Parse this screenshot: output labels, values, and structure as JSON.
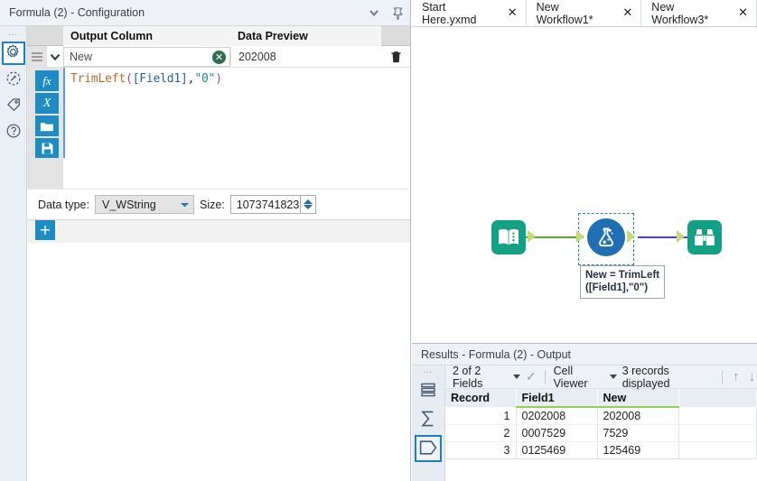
{
  "config_panel": {
    "title": "Formula (2) - Configuration",
    "collapse_icon": "chevron-down-icon",
    "pin_icon": "pushpin-icon",
    "rail": {
      "items": [
        {
          "name": "gear-icon",
          "label": "Configuration",
          "selected": true
        },
        {
          "name": "arrow-circle-icon",
          "label": "Annotation",
          "selected": false
        },
        {
          "name": "tag-icon",
          "label": "Tool Tags",
          "selected": false
        },
        {
          "name": "help-icon",
          "label": "Help",
          "selected": false
        }
      ]
    },
    "grid": {
      "headers": [
        "Output Column",
        "Data Preview"
      ],
      "row": {
        "output_column_value": "New",
        "data_preview_value": "202008",
        "clear_icon": "clear-circle-icon",
        "delete_icon": "trash-icon",
        "grip_icon": "drag-handle-icon",
        "chevron_icon": "chevron-down-icon"
      }
    },
    "formula": {
      "expression": "TrimLeft([Field1],\"0\")",
      "tokens": {
        "function": "TrimLeft",
        "open_paren": "(",
        "field": "[Field1]",
        "comma": ",",
        "string": "\"0\"",
        "close_paren": ")"
      },
      "tools": [
        {
          "name": "fx-icon",
          "label": "fx"
        },
        {
          "name": "variable-x-icon",
          "label": "X"
        },
        {
          "name": "open-folder-icon",
          "label": "Open"
        },
        {
          "name": "save-disk-icon",
          "label": "Save"
        }
      ]
    },
    "data_type": {
      "label": "Data type:",
      "value": "V_WString",
      "size_label": "Size:",
      "size_value": "1073741823"
    },
    "add_button_label": "+"
  },
  "tabs": [
    {
      "label": "Start Here.yxmd",
      "close_icon": "close-icon",
      "active": false
    },
    {
      "label": "New Workflow1*",
      "close_icon": "close-icon",
      "active": false
    },
    {
      "label": "New Workflow3*",
      "close_icon": "close-icon",
      "active": true
    }
  ],
  "canvas": {
    "nodes": [
      {
        "name": "input-data-tool",
        "icon": "book-icon",
        "color": "#13a085"
      },
      {
        "name": "formula-tool",
        "icon": "flask-icon",
        "color": "#1f6fb2",
        "selected": true
      },
      {
        "name": "browse-tool",
        "icon": "binoculars-icon",
        "color": "#13a085"
      }
    ],
    "annotation_line1": "New = TrimLeft",
    "annotation_line2": "([Field1],\"0\")",
    "connection_colors": {
      "input_to_formula": "#5aa832",
      "formula_to_browse": "#4b3fd0"
    }
  },
  "results": {
    "title": "Results - Formula (2) - Output",
    "rail": [
      {
        "name": "records-icon",
        "selected": false
      },
      {
        "name": "sigma-icon",
        "selected": false
      },
      {
        "name": "metadata-icon",
        "selected": true
      }
    ],
    "toolbar": {
      "fields_label": "2 of 2 Fields",
      "check_icon": "checkmark-icon",
      "viewer_label": "Cell Viewer",
      "records_label": "3 records displayed",
      "up_arrow_icon": "arrow-up-icon",
      "down_arrow_icon": "arrow-down-icon"
    },
    "table": {
      "headers": [
        "Record",
        "Field1",
        "New"
      ],
      "rows": [
        {
          "record": "1",
          "field1": "0202008",
          "new": "202008"
        },
        {
          "record": "2",
          "field1": "0007529",
          "new": "7529"
        },
        {
          "record": "3",
          "field1": "0125469",
          "new": "125469"
        }
      ]
    }
  }
}
